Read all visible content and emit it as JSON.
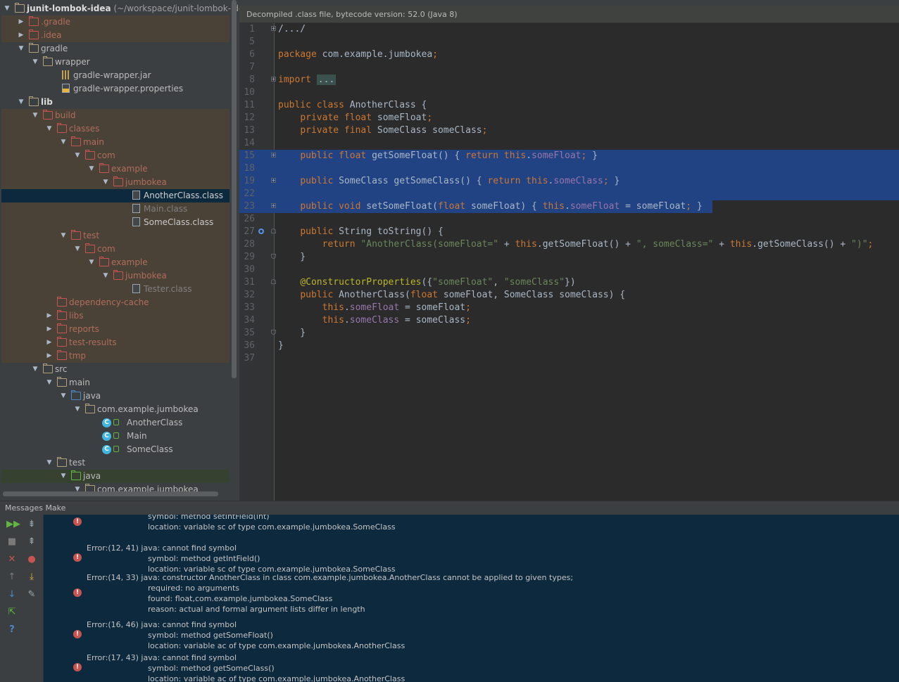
{
  "project": {
    "tree": [
      {
        "label": "junit-lombok-idea",
        "suffix": " (~/workspace/junit-lombok-ide",
        "depth": 0,
        "arrow": "down",
        "icon": "folder",
        "bold": true,
        "row": "root"
      },
      {
        "label": ".gradle",
        "depth": 1,
        "arrow": "right",
        "icon": "folder-red",
        "row": "excluded"
      },
      {
        "label": ".idea",
        "depth": 1,
        "arrow": "right",
        "icon": "folder-red",
        "row": "excluded"
      },
      {
        "label": "gradle",
        "depth": 1,
        "arrow": "down",
        "icon": "folder",
        "row": "normal"
      },
      {
        "label": "wrapper",
        "depth": 2,
        "arrow": "down",
        "icon": "folder",
        "row": "normal"
      },
      {
        "label": "gradle-wrapper.jar",
        "depth": 3,
        "arrow": "",
        "icon": "jar",
        "row": "normal"
      },
      {
        "label": "gradle-wrapper.properties",
        "depth": 3,
        "arrow": "",
        "icon": "props",
        "row": "normal"
      },
      {
        "label": "lib",
        "depth": 1,
        "arrow": "down",
        "icon": "folder",
        "bold": true,
        "row": "normal"
      },
      {
        "label": "build",
        "depth": 2,
        "arrow": "down",
        "icon": "folder-red",
        "row": "excluded"
      },
      {
        "label": "classes",
        "depth": 3,
        "arrow": "down",
        "icon": "folder-red",
        "row": "excluded"
      },
      {
        "label": "main",
        "depth": 4,
        "arrow": "down",
        "icon": "folder-red",
        "row": "excluded"
      },
      {
        "label": "com",
        "depth": 5,
        "arrow": "down",
        "icon": "folder-red",
        "row": "excluded"
      },
      {
        "label": "example",
        "depth": 6,
        "arrow": "down",
        "icon": "folder-red",
        "row": "excluded"
      },
      {
        "label": "jumbokea",
        "depth": 7,
        "arrow": "down",
        "icon": "folder-red",
        "row": "excluded"
      },
      {
        "label": "AnotherClass.class",
        "depth": 8,
        "arrow": "",
        "icon": "file",
        "row": "selected"
      },
      {
        "label": "Main.class",
        "depth": 8,
        "arrow": "",
        "icon": "file",
        "row": "excluded-dim"
      },
      {
        "label": "SomeClass.class",
        "depth": 8,
        "arrow": "",
        "icon": "file",
        "row": "excluded-light"
      },
      {
        "label": "test",
        "depth": 4,
        "arrow": "down",
        "icon": "folder-red",
        "row": "excluded"
      },
      {
        "label": "com",
        "depth": 5,
        "arrow": "down",
        "icon": "folder-red",
        "row": "excluded"
      },
      {
        "label": "example",
        "depth": 6,
        "arrow": "down",
        "icon": "folder-red",
        "row": "excluded"
      },
      {
        "label": "jumbokea",
        "depth": 7,
        "arrow": "down",
        "icon": "folder-red",
        "row": "excluded"
      },
      {
        "label": "Tester.class",
        "depth": 8,
        "arrow": "",
        "icon": "file",
        "row": "excluded-dim"
      },
      {
        "label": "dependency-cache",
        "depth": 3,
        "arrow": "",
        "icon": "folder-red",
        "row": "excluded"
      },
      {
        "label": "libs",
        "depth": 3,
        "arrow": "right",
        "icon": "folder-red",
        "row": "excluded"
      },
      {
        "label": "reports",
        "depth": 3,
        "arrow": "right",
        "icon": "folder-red",
        "row": "excluded"
      },
      {
        "label": "test-results",
        "depth": 3,
        "arrow": "right",
        "icon": "folder-red",
        "row": "excluded"
      },
      {
        "label": "tmp",
        "depth": 3,
        "arrow": "right",
        "icon": "folder-red",
        "row": "excluded"
      },
      {
        "label": "src",
        "depth": 2,
        "arrow": "down",
        "icon": "folder",
        "row": "normal"
      },
      {
        "label": "main",
        "depth": 3,
        "arrow": "down",
        "icon": "folder",
        "row": "normal"
      },
      {
        "label": "java",
        "depth": 4,
        "arrow": "down",
        "icon": "folder-blue",
        "row": "normal"
      },
      {
        "label": "com.example.jumbokea",
        "depth": 5,
        "arrow": "down",
        "icon": "folder",
        "row": "normal"
      },
      {
        "label": "AnotherClass",
        "depth": 7,
        "arrow": "",
        "icon": "class",
        "row": "normal"
      },
      {
        "label": "Main",
        "depth": 7,
        "arrow": "",
        "icon": "class",
        "row": "normal"
      },
      {
        "label": "SomeClass",
        "depth": 7,
        "arrow": "",
        "icon": "class",
        "row": "normal"
      },
      {
        "label": "test",
        "depth": 3,
        "arrow": "down",
        "icon": "folder",
        "row": "normal"
      },
      {
        "label": "java",
        "depth": 4,
        "arrow": "down",
        "icon": "folder-green",
        "row": "testsel"
      },
      {
        "label": "com.example.jumbokea",
        "depth": 5,
        "arrow": "down",
        "icon": "folder",
        "row": "normal"
      }
    ]
  },
  "editor": {
    "banner": "Decompiled .class file, bytecode version: 52.0 (Java 8)",
    "lines": [
      {
        "n": "1",
        "fold": "plus",
        "tokens": [
          [
            "plain",
            "/.../"
          ]
        ]
      },
      {
        "n": "5",
        "tokens": []
      },
      {
        "n": "6",
        "tokens": [
          [
            "kw",
            "package "
          ],
          [
            "plain",
            "com.example.jumbokea"
          ],
          [
            "kw",
            ";"
          ]
        ]
      },
      {
        "n": "7",
        "tokens": []
      },
      {
        "n": "8",
        "fold": "plus",
        "tokens": [
          [
            "kw",
            "import "
          ],
          [
            "box",
            "..."
          ]
        ]
      },
      {
        "n": "10",
        "tokens": []
      },
      {
        "n": "11",
        "tokens": [
          [
            "kw",
            "public class "
          ],
          [
            "plain",
            "AnotherClass {"
          ]
        ]
      },
      {
        "n": "12",
        "tokens": [
          [
            "plain",
            "    "
          ],
          [
            "kw",
            "private float "
          ],
          [
            "plain",
            "someFloat"
          ],
          [
            "kw",
            ";"
          ]
        ]
      },
      {
        "n": "13",
        "tokens": [
          [
            "plain",
            "    "
          ],
          [
            "kw",
            "private final "
          ],
          [
            "plain",
            "SomeClass someClass"
          ],
          [
            "kw",
            ";"
          ]
        ]
      },
      {
        "n": "14",
        "tokens": []
      },
      {
        "n": "15",
        "fold": "plus",
        "sel": true,
        "tokens": [
          [
            "plain",
            "    "
          ],
          [
            "kw",
            "public float "
          ],
          [
            "plain",
            "getSomeFloat() { "
          ],
          [
            "kw",
            "return this"
          ],
          [
            "plain",
            "."
          ],
          [
            "fld",
            "someFloat"
          ],
          [
            "kw",
            "; "
          ],
          [
            "plain",
            "}"
          ]
        ]
      },
      {
        "n": "18",
        "sel": true,
        "tokens": []
      },
      {
        "n": "19",
        "fold": "plus",
        "sel": true,
        "tokens": [
          [
            "plain",
            "    "
          ],
          [
            "kw",
            "public "
          ],
          [
            "plain",
            "SomeClass getSomeClass() { "
          ],
          [
            "kw",
            "return this"
          ],
          [
            "plain",
            "."
          ],
          [
            "fld",
            "someClass"
          ],
          [
            "kw",
            "; "
          ],
          [
            "plain",
            "}"
          ]
        ]
      },
      {
        "n": "22",
        "sel": true,
        "tokens": []
      },
      {
        "n": "23",
        "fold": "plus",
        "sel": true,
        "seltrim": true,
        "tokens": [
          [
            "plain",
            "    "
          ],
          [
            "kw",
            "public void "
          ],
          [
            "plain",
            "setSomeFloat("
          ],
          [
            "kw",
            "float "
          ],
          [
            "plain",
            "someFloat) { "
          ],
          [
            "kw",
            "this"
          ],
          [
            "plain",
            "."
          ],
          [
            "fld",
            "someFloat"
          ],
          [
            "plain",
            " = someFloat"
          ],
          [
            "kw",
            "; "
          ],
          [
            "plain",
            "}"
          ]
        ]
      },
      {
        "n": "26",
        "tokens": []
      },
      {
        "n": "27",
        "fold": "open",
        "mark": true,
        "tokens": [
          [
            "plain",
            "    "
          ],
          [
            "kw",
            "public "
          ],
          [
            "plain",
            "String toString() {"
          ]
        ]
      },
      {
        "n": "28",
        "tokens": [
          [
            "plain",
            "        "
          ],
          [
            "kw",
            "return "
          ],
          [
            "str",
            "\"AnotherClass(someFloat=\""
          ],
          [
            "plain",
            " + "
          ],
          [
            "kw",
            "this"
          ],
          [
            "plain",
            ".getSomeFloat() + "
          ],
          [
            "str",
            "\", someClass=\""
          ],
          [
            "plain",
            " + "
          ],
          [
            "kw",
            "this"
          ],
          [
            "plain",
            ".getSomeClass() + "
          ],
          [
            "str",
            "\")\""
          ],
          [
            "kw",
            ";"
          ]
        ]
      },
      {
        "n": "29",
        "fold": "close",
        "tokens": [
          [
            "plain",
            "    }"
          ]
        ]
      },
      {
        "n": "30",
        "tokens": []
      },
      {
        "n": "31",
        "fold": "open",
        "tokens": [
          [
            "plain",
            "    "
          ],
          [
            "an",
            "@ConstructorProperties"
          ],
          [
            "plain",
            "({"
          ],
          [
            "str",
            "\"someFloat\""
          ],
          [
            "plain",
            ", "
          ],
          [
            "str",
            "\"someClass\""
          ],
          [
            "plain",
            "})"
          ]
        ]
      },
      {
        "n": "32",
        "tokens": [
          [
            "plain",
            "    "
          ],
          [
            "kw",
            "public "
          ],
          [
            "plain",
            "AnotherClass("
          ],
          [
            "kw",
            "float "
          ],
          [
            "plain",
            "someFloat, SomeClass someClass) {"
          ]
        ]
      },
      {
        "n": "33",
        "tokens": [
          [
            "plain",
            "        "
          ],
          [
            "kw",
            "this"
          ],
          [
            "plain",
            "."
          ],
          [
            "fld",
            "someFloat"
          ],
          [
            "plain",
            " = someFloat"
          ],
          [
            "kw",
            ";"
          ]
        ]
      },
      {
        "n": "34",
        "tokens": [
          [
            "plain",
            "        "
          ],
          [
            "kw",
            "this"
          ],
          [
            "plain",
            "."
          ],
          [
            "fld",
            "someClass"
          ],
          [
            "plain",
            " = someClass"
          ],
          [
            "kw",
            ";"
          ]
        ]
      },
      {
        "n": "35",
        "fold": "close",
        "tokens": [
          [
            "plain",
            "    }"
          ]
        ]
      },
      {
        "n": "36",
        "tokens": [
          [
            "plain",
            "}"
          ]
        ]
      },
      {
        "n": "37",
        "tokens": []
      }
    ]
  },
  "messages": {
    "title": "Messages Make",
    "errors": [
      {
        "head": "",
        "lines": [
          "symbol:   method setIntField(int)",
          "location: variable sc of type com.example.jumbokea.SomeClass"
        ]
      },
      {
        "head": "Error:(12, 41)  java: cannot find symbol",
        "lines": [
          "symbol:   method getIntField()",
          "location: variable sc of type com.example.jumbokea.SomeClass"
        ]
      },
      {
        "head": "Error:(14, 33)  java: constructor AnotherClass in class com.example.jumbokea.AnotherClass cannot be applied to given types;",
        "lines": [
          "required: no arguments",
          "found: float,com.example.jumbokea.SomeClass",
          "reason: actual and formal argument lists differ in length"
        ]
      },
      {
        "head": "Error:(16, 46)  java: cannot find symbol",
        "lines": [
          "symbol:   method getSomeFloat()",
          "location: variable ac of type com.example.jumbokea.AnotherClass"
        ]
      },
      {
        "head": "Error:(17, 43)  java: cannot find symbol",
        "lines": [
          "symbol:   method getSomeClass()",
          "location: variable ac of type com.example.jumbokea.AnotherClass"
        ]
      }
    ]
  },
  "colors": {
    "selection": "#214283",
    "keyword": "#cc7832",
    "string": "#6a8759",
    "field": "#9876aa",
    "annotation": "#bbb529",
    "error": "#c75450"
  }
}
